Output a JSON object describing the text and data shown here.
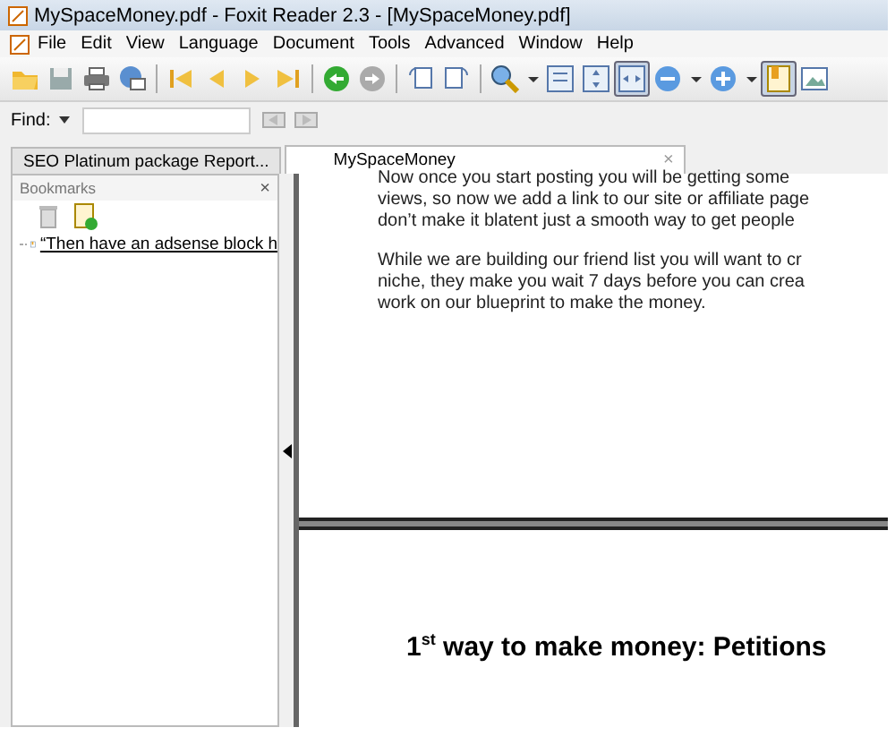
{
  "window": {
    "title": "MySpaceMoney.pdf - Foxit Reader 2.3 - [MySpaceMoney.pdf]"
  },
  "menu": [
    "File",
    "Edit",
    "View",
    "Language",
    "Document",
    "Tools",
    "Advanced",
    "Window",
    "Help"
  ],
  "toolbar": [
    {
      "kind": "open",
      "pressed": false
    },
    {
      "kind": "save",
      "pressed": false
    },
    {
      "kind": "print",
      "pressed": false
    },
    {
      "kind": "email",
      "pressed": false
    },
    {
      "kind": "sep"
    },
    {
      "kind": "first",
      "pressed": false
    },
    {
      "kind": "prev",
      "pressed": false
    },
    {
      "kind": "next",
      "pressed": false
    },
    {
      "kind": "last",
      "pressed": false
    },
    {
      "kind": "sep"
    },
    {
      "kind": "back",
      "pressed": false
    },
    {
      "kind": "forward",
      "pressed": false
    },
    {
      "kind": "sep"
    },
    {
      "kind": "rotate-left",
      "pressed": false
    },
    {
      "kind": "rotate-right",
      "pressed": false
    },
    {
      "kind": "sep"
    },
    {
      "kind": "zoom",
      "pressed": false
    },
    {
      "kind": "caret",
      "pressed": false
    },
    {
      "kind": "actual-size",
      "pressed": false
    },
    {
      "kind": "fit-page",
      "pressed": false
    },
    {
      "kind": "fit-width",
      "pressed": true
    },
    {
      "kind": "zoom-out",
      "pressed": false
    },
    {
      "kind": "caret",
      "pressed": false
    },
    {
      "kind": "zoom-in",
      "pressed": false
    },
    {
      "kind": "caret",
      "pressed": false
    },
    {
      "kind": "panel",
      "pressed": true
    },
    {
      "kind": "pages",
      "pressed": false
    }
  ],
  "find": {
    "label": "Find:"
  },
  "tabs": [
    {
      "label": "SEO Platinum package Report...",
      "selected": false
    },
    {
      "label": "MySpaceMoney",
      "selected": true,
      "close": "×"
    }
  ],
  "bookmarks": {
    "title": "Bookmarks",
    "close": "×",
    "items": [
      {
        "label": "“Then have an adsense block h"
      }
    ]
  },
  "document": {
    "paragraphs": [
      [
        "Now once you start posting you will be getting some",
        "views, so now we add a link to our site or affiliate page",
        "don’t make it blatent just a smooth way to get people"
      ],
      [
        "While we are building our friend list you will want to cr",
        "niche, they make you wait 7 days before you can crea",
        "work on our blueprint to make the money."
      ]
    ],
    "heading": "1$^{st}$ way to make money: Petitions"
  }
}
